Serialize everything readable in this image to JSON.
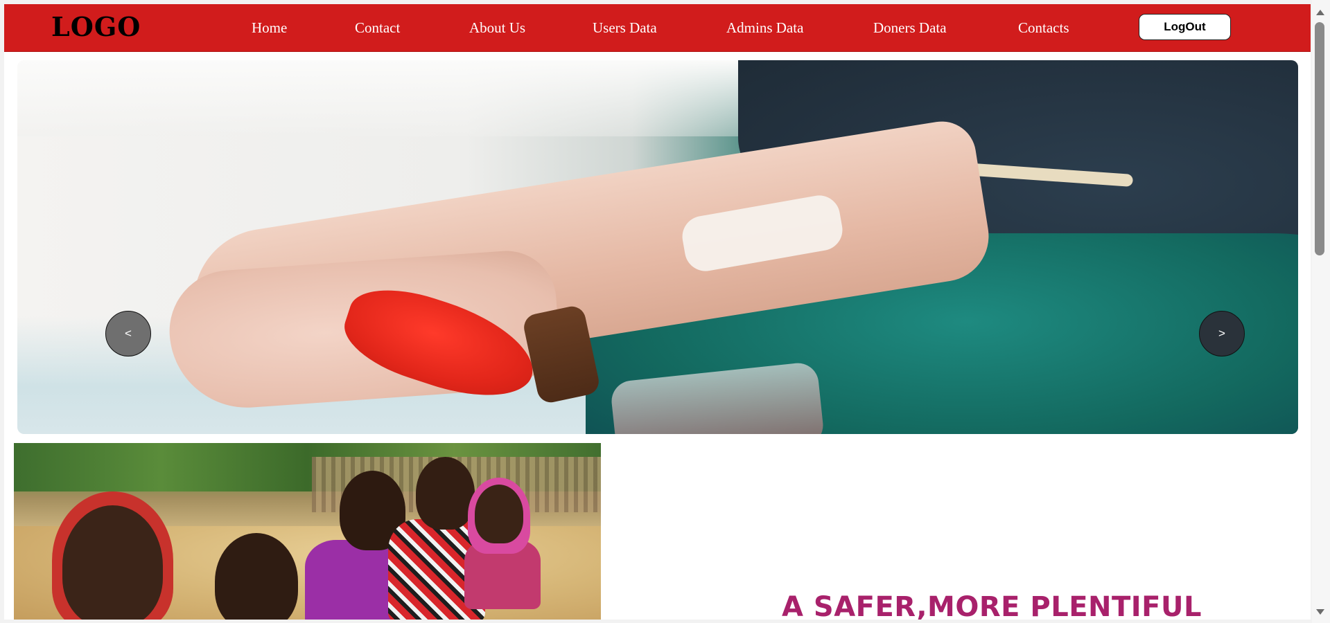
{
  "navbar": {
    "logo": "LOGO",
    "links": [
      "Home",
      "Contact",
      "About Us",
      "Users Data",
      "Admins Data",
      "Doners Data",
      "Contacts"
    ],
    "logout_label": "LogOut",
    "background_color": "#d11c1c"
  },
  "carousel": {
    "prev_label": "<",
    "next_label": ">"
  },
  "section": {
    "headline": "A SAFER,MORE PLENTIFUL",
    "headline_color": "#a8216b"
  }
}
